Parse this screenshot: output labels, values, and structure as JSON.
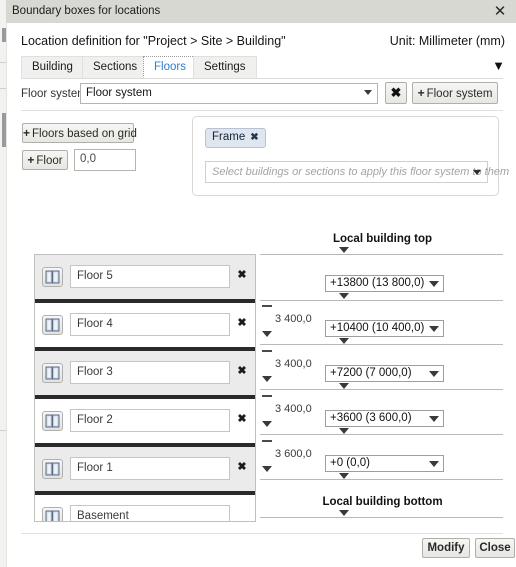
{
  "window": {
    "title": "Boundary boxes for locations",
    "close_icon": "close-icon"
  },
  "header": {
    "definition": "Location definition for \"Project > Site > Building\"",
    "unit": "Unit: Millimeter (mm)",
    "expander_icon": "chevron-down-icon"
  },
  "tabs": [
    {
      "label": "Building",
      "active": false
    },
    {
      "label": "Sections",
      "active": false
    },
    {
      "label": "Floors",
      "active": true
    },
    {
      "label": "Settings",
      "active": false
    }
  ],
  "floor_system": {
    "label": "Floor system",
    "selected": "Floor system",
    "clear_label": "✖",
    "add_label": "Floor system",
    "add_plus": "+"
  },
  "left_actions": {
    "grid_button": "Floors based on grid",
    "floor_button": "Floor",
    "plus": "+",
    "offset_value": "0,0"
  },
  "apply_panel": {
    "tag": "Frame",
    "tag_remove": "✖",
    "placeholder": "Select buildings or sections to apply this floor system to them"
  },
  "floors": [
    {
      "name": "Floor 5",
      "deletable": true,
      "shade": true
    },
    {
      "name": "Floor 4",
      "deletable": true,
      "shade": false
    },
    {
      "name": "Floor 3",
      "deletable": true,
      "shade": true
    },
    {
      "name": "Floor 2",
      "deletable": true,
      "shade": false
    },
    {
      "name": "Floor 1",
      "deletable": true,
      "shade": true
    },
    {
      "name": "Basement",
      "deletable": false,
      "shade": false
    }
  ],
  "delete_glyph": "✖",
  "elevation": {
    "top_label": "Local building top",
    "bottom_label": "Local building bottom",
    "levels": [
      {
        "value": "+13800 (13 800,0)",
        "gap": ""
      },
      {
        "value": "+10400 (10 400,0)",
        "gap": "3 400,0"
      },
      {
        "value": "+7200 (7 000,0)",
        "gap": "3 400,0"
      },
      {
        "value": "+3600 (3 600,0)",
        "gap": "3 400,0"
      },
      {
        "value": "+0 (0,0)",
        "gap": "3 600,0"
      }
    ]
  },
  "footer": {
    "modify": "Modify",
    "close": "Close"
  },
  "colors": {
    "accent": "#2f7fd0",
    "tag_bg": "#dfe6ef",
    "titlebar": "#d8d8d2",
    "row_shade": "#ebebeb",
    "separator": "#2a2a2a"
  }
}
